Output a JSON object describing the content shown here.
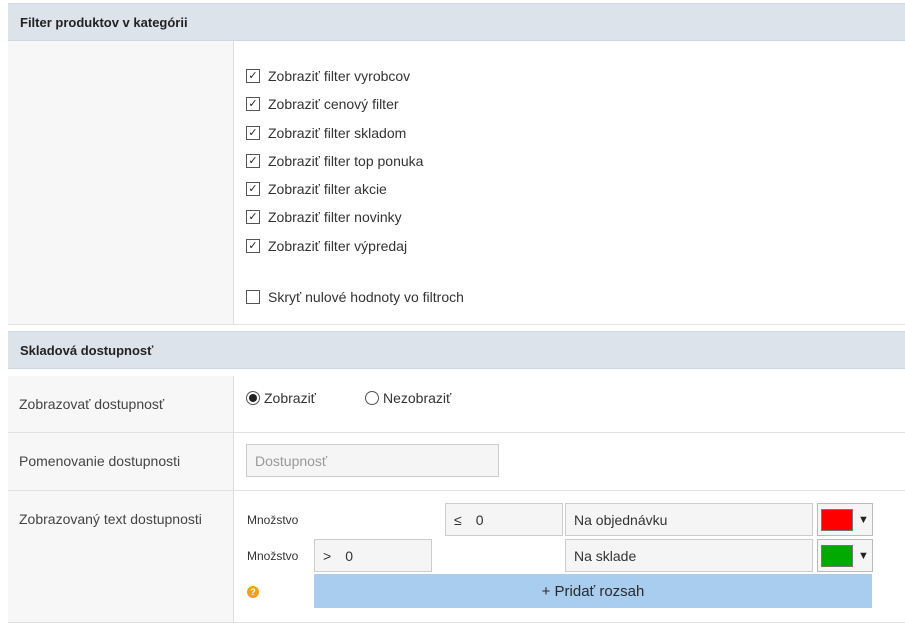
{
  "sections": {
    "filter_header": "Filter produktov v kategórii",
    "stock_header": "Skladová dostupnosť"
  },
  "filters": {
    "items": [
      {
        "label": "Zobraziť filter vyrobcov",
        "checked": true
      },
      {
        "label": "Zobraziť cenový filter",
        "checked": true
      },
      {
        "label": "Zobraziť filter skladom",
        "checked": true
      },
      {
        "label": "Zobraziť filter top ponuka",
        "checked": true
      },
      {
        "label": "Zobraziť filter akcie",
        "checked": true
      },
      {
        "label": "Zobraziť filter novinky",
        "checked": true
      },
      {
        "label": "Zobraziť filter výpredaj",
        "checked": true
      }
    ],
    "hide_zero": {
      "label": "Skryť nulové hodnoty vo filtroch",
      "checked": false
    }
  },
  "availability": {
    "show_label": "Zobrazovať dostupnosť",
    "show_options": [
      {
        "label": "Zobraziť",
        "selected": true
      },
      {
        "label": "Nezobraziť",
        "selected": false
      }
    ],
    "name_label": "Pomenovanie dostupnosti",
    "name_placeholder": "Dostupnosť",
    "text_label": "Zobrazovaný text dostupnosti",
    "ranges": [
      {
        "qty_label": "Množstvo",
        "operator": "≤",
        "value": "0",
        "text": "Na objednávku",
        "color": "#ff0000"
      },
      {
        "qty_label": "Množstvo",
        "operator": ">",
        "value": "0",
        "text": "Na sklade",
        "color": "#00aa00"
      }
    ],
    "add_range_label": "+ Pridať rozsah",
    "help_icon": "?",
    "dropdown_arrow": "▼"
  }
}
